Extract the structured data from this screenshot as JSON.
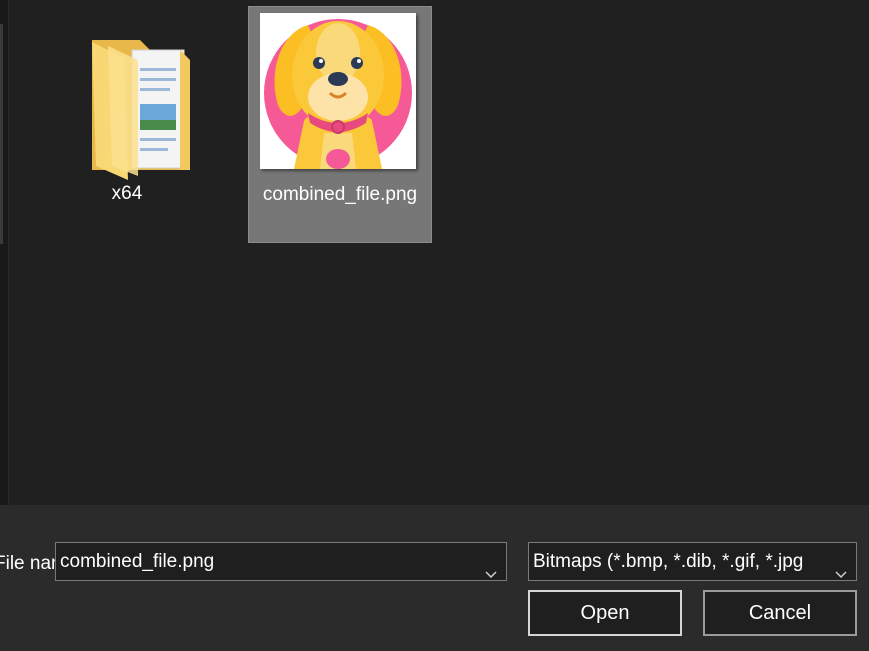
{
  "files": [
    {
      "name": "x64",
      "type": "folder",
      "icon": "folder-icon",
      "selected": false
    },
    {
      "name": "combined_file.png",
      "type": "image",
      "icon": "dog-thumbnail",
      "selected": true
    }
  ],
  "bottom": {
    "filename_label": "File name:",
    "filename_value": "combined_file.png",
    "filetype_value": "Bitmaps (*.bmp, *.dib, *.gif, *.jpg",
    "open_label": "Open",
    "cancel_label": "Cancel"
  },
  "colors": {
    "background": "#202020",
    "selection": "#777777",
    "bottom_bar": "#2b2b2b",
    "folder": "#f8d775",
    "thumb_pink": "#f65a96",
    "dog_yellow": "#fbc83a"
  }
}
